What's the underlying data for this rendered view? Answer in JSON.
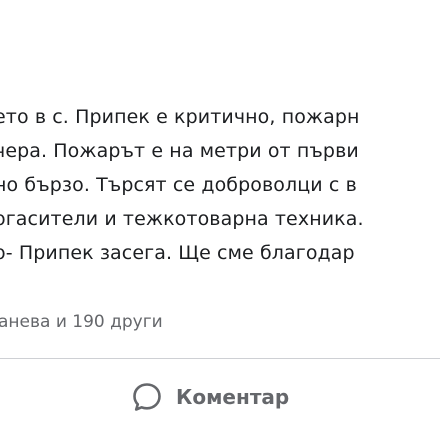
{
  "post": {
    "text_lines": [
      "ето в с. Припек е критично, пожарн",
      "чера. Пожарът е на метри от първи",
      "но бързо. Търсят се доброволци с в",
      "огасители и тежкотоварна техника.",
      "о- Припек засега. Ще сме благодар"
    ]
  },
  "reactions": {
    "text": "анева и 190 други"
  },
  "actions": {
    "comment_label": "Коментар",
    "comment_icon": "comment-bubble-icon"
  },
  "colors": {
    "text": "#1c1e21",
    "secondary": "#65676b",
    "divider": "#ced0d4",
    "background": "#ffffff"
  }
}
